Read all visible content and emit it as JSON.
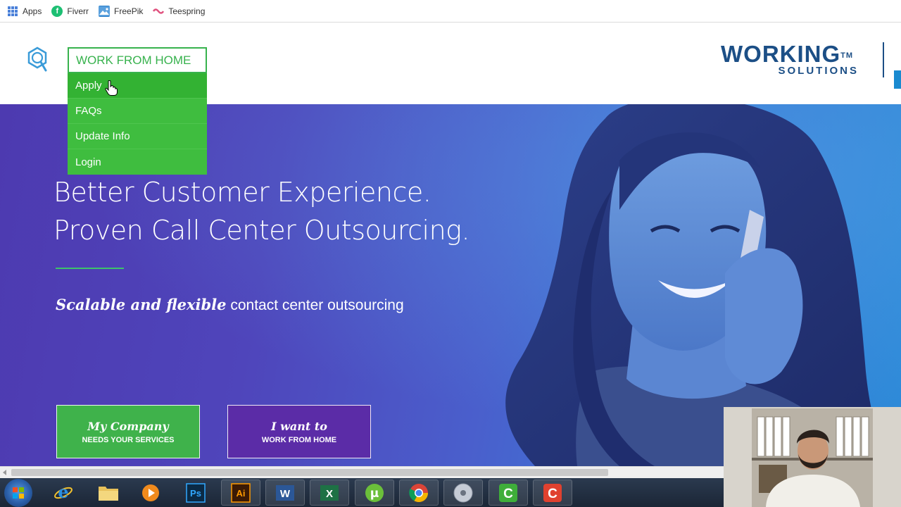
{
  "bookmarks": [
    {
      "label": "Apps",
      "icon": "apps-grid-icon"
    },
    {
      "label": "Fiverr",
      "icon": "fiverr-icon"
    },
    {
      "label": "FreePik",
      "icon": "freepik-icon"
    },
    {
      "label": "Teespring",
      "icon": "teespring-icon"
    }
  ],
  "header": {
    "logo_main": "WORKING",
    "logo_tm": "TM",
    "logo_sub": "SOLUTIONS",
    "brand_color": "#1c4f86"
  },
  "nav": {
    "title": "WORK FROM HOME",
    "items": [
      {
        "label": "Apply",
        "state": "hovered"
      },
      {
        "label": "FAQs"
      },
      {
        "label": "Update Info"
      },
      {
        "label": "Login"
      }
    ],
    "accent": "#3fbd3f"
  },
  "hero": {
    "title_line1": "Better Customer Experience.",
    "title_line2": "Proven Call Center Outsourcing.",
    "subtitle_emphasis": "Scalable and flexible",
    "subtitle_rest": " contact center outsourcing",
    "button_company": {
      "line1": "My Company",
      "line2": "NEEDS YOUR SERVICES",
      "color": "#3fb24b"
    },
    "button_home": {
      "line1": "I want to",
      "line2": "WORK FROM HOME",
      "color": "#5b2ca7"
    }
  },
  "taskbar": {
    "apps": [
      {
        "name": "internet-explorer-icon",
        "label": "e"
      },
      {
        "name": "file-explorer-icon"
      },
      {
        "name": "media-player-icon"
      },
      {
        "name": "photoshop-icon",
        "label": "Ps"
      },
      {
        "name": "illustrator-icon",
        "label": "Ai"
      },
      {
        "name": "word-icon",
        "label": "W"
      },
      {
        "name": "excel-icon",
        "label": "X"
      },
      {
        "name": "utorrent-icon",
        "label": "μ"
      },
      {
        "name": "chrome-icon"
      },
      {
        "name": "disc-icon"
      },
      {
        "name": "camtasia-green-icon",
        "label": "C"
      },
      {
        "name": "camtasia-red-icon",
        "label": "C"
      }
    ]
  }
}
